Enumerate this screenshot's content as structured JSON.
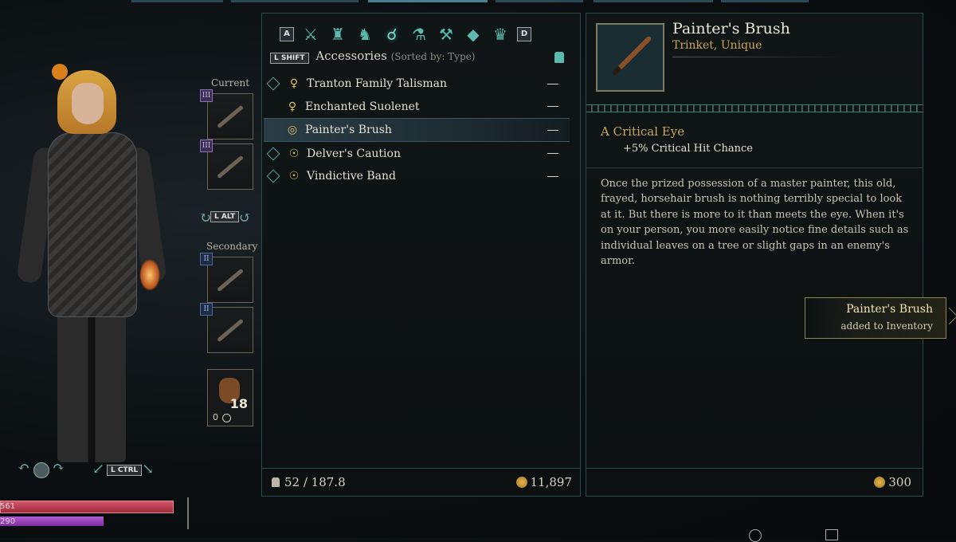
{
  "character": {
    "current_label": "Current",
    "secondary_label": "Secondary",
    "slot_rank_primary": "III",
    "slot_rank_secondary": "II",
    "swap_key": "L ALT",
    "view_key": "L CTRL",
    "ammo_count": "18",
    "ammo_sub": "0",
    "health_value": "561",
    "mana_value": "290"
  },
  "inventory": {
    "nav_left_key": "A",
    "nav_right_key": "D",
    "categories": [
      {
        "icon": "crossed-swords-icon",
        "glyph": "⚔"
      },
      {
        "icon": "armor-icon",
        "glyph": "♜"
      },
      {
        "icon": "boots-icon",
        "glyph": "♞"
      },
      {
        "icon": "accessories-icon",
        "glyph": "☌"
      },
      {
        "icon": "potion-icon",
        "glyph": "⚗"
      },
      {
        "icon": "anvil-icon",
        "glyph": "⚒"
      },
      {
        "icon": "gem-icon",
        "glyph": "◆"
      },
      {
        "icon": "crown-icon",
        "glyph": "♛"
      }
    ],
    "sort_key": "L SHIFT",
    "header_title": "Accessories",
    "sorted_by": "(Sorted by: Type)",
    "items": [
      {
        "name": "Tranton Family Talisman",
        "icon_glyph": "♀",
        "tracked": true,
        "selected": false,
        "value": "—"
      },
      {
        "name": "Enchanted Suolenet",
        "icon_glyph": "♀",
        "tracked": false,
        "selected": false,
        "value": "—"
      },
      {
        "name": "Painter's Brush",
        "icon_glyph": "◎",
        "tracked": false,
        "selected": true,
        "value": "—"
      },
      {
        "name": "Delver's Caution",
        "icon_glyph": "☉",
        "tracked": true,
        "selected": false,
        "value": "—"
      },
      {
        "name": "Vindictive Band",
        "icon_glyph": "☉",
        "tracked": true,
        "selected": false,
        "value": "—"
      }
    ],
    "weight": "52 / 187.8",
    "gold": "11,897"
  },
  "detail": {
    "title": "Painter's Brush",
    "subtitle": "Trinket, Unique",
    "stat_title": "A Critical Eye",
    "stat_line": "+5% Critical Hit Chance",
    "description": "Once the prized possession of a master painter, this old, frayed, horsehair brush is nothing terribly special to look at it. But there is more to it than meets the eye. When it's on your person, you more easily notice fine details such as individual leaves on a tree or slight gaps in an enemy's armor.",
    "price": "300"
  },
  "notification": {
    "title": "Painter's Brush",
    "subtitle": "added to Inventory"
  },
  "colors": {
    "accent_teal": "#5bb9ad",
    "gold_text": "#c8a75a",
    "health": "#c23d52",
    "mana": "#8c3ab3"
  }
}
